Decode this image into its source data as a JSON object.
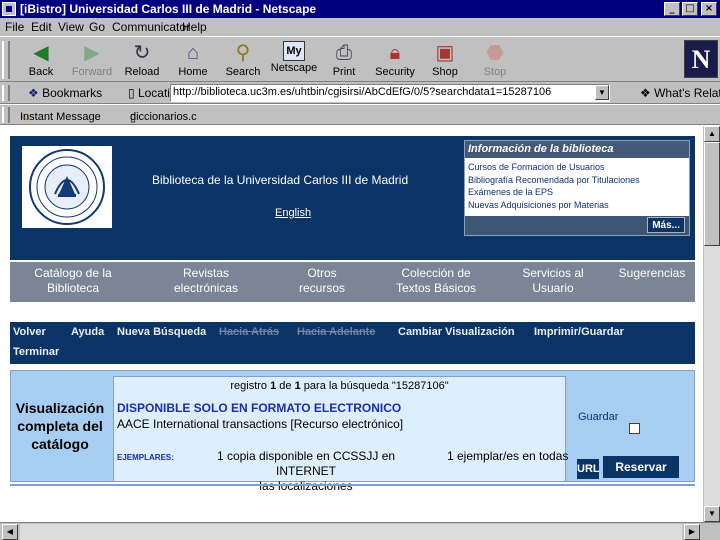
{
  "window": {
    "title": "[iBistro] Universidad Carlos III de Madrid - Netscape",
    "min": "_",
    "max": "□",
    "close": "×"
  },
  "menu": [
    "File",
    "Edit",
    "View",
    "Go",
    "Communicator",
    "Help"
  ],
  "toolbar": {
    "buttons": [
      {
        "label": "Back",
        "icon": "back-icon",
        "disabled": false
      },
      {
        "label": "Forward",
        "icon": "forward-icon",
        "disabled": true
      },
      {
        "label": "Reload",
        "icon": "reload-icon",
        "disabled": false
      },
      {
        "label": "Home",
        "icon": "home-icon",
        "disabled": false
      },
      {
        "label": "Search",
        "icon": "search-icon",
        "disabled": false
      },
      {
        "label": "Netscape",
        "icon": "netscape-icon",
        "disabled": false
      },
      {
        "label": "Print",
        "icon": "print-icon",
        "disabled": false
      },
      {
        "label": "Security",
        "icon": "security-icon",
        "disabled": false
      },
      {
        "label": "Shop",
        "icon": "shop-icon",
        "disabled": false
      },
      {
        "label": "Stop",
        "icon": "stop-icon",
        "disabled": true
      }
    ],
    "logo": "N"
  },
  "location": {
    "bookmarks_label": "Bookmarks",
    "location_label": "Location:",
    "url": "http://biblioteca.uc3m.es/uhtbin/cgisirsi/AbCdEfG/0/5?searchdata1=15287106",
    "related_label": "What's Related"
  },
  "personal": {
    "instant_message": "Instant Message",
    "diccionarios": "diccionarios.c"
  },
  "page": {
    "library_title": "Biblioteca de la Universidad Carlos III de Madrid",
    "english_link": "English",
    "info_box": {
      "title": "Información de la biblioteca",
      "items": [
        "Cursos de Formación de Usuarios",
        "Bibliografía Recomendada por Titulaciones",
        "Exámenes de la EPS",
        "Nuevas Adquisiciones por Materias"
      ],
      "more_button": "Más..."
    },
    "main_nav": [
      "Catálogo de la\nBiblioteca",
      "Revistas\nelectrónicas",
      "Otros\nrecursos",
      "Colección de\nTextos Básicos",
      "Servicios al\nUsuario",
      "Sugerencias"
    ],
    "tools": {
      "volver": "Volver",
      "ayuda": "Ayuda",
      "nueva_busqueda": "Nueva Búsqueda",
      "hacia_atras": "Hacia Atrás",
      "hacia_adelante": "Hacia Adelante",
      "cambiar": "Cambiar Visualización",
      "imprimir": "Imprimir/Guardar",
      "terminar": "Terminar"
    },
    "result": {
      "side_label": "Visualización completa del catálogo",
      "registro_prefix": "registro",
      "registro_num": "1",
      "registro_de": "de",
      "registro_total": "1",
      "registro_suffix": "para la búsqueda \"15287106\"",
      "disponible": "DISPONIBLE SOLO EN FORMATO ELECTRONICO",
      "title": "AACE International transactions [Recurso electrónico]",
      "ejemplares_label": "EJEMPLARES:",
      "ejemplares_text": "1 copia disponible en CCSSJJ en INTERNET",
      "ejemplares_localizaciones": "las localizaciones",
      "ejemplares_todas": "1 ejemplar/es en todas",
      "guardar": "Guardar",
      "url_badge": "URL",
      "reservar": "Reservar"
    }
  },
  "colors": {
    "title_bar": "#00007f",
    "chrome": "#c0c0c0",
    "header_navy": "#0b3466",
    "nav_gray": "#7b8596",
    "result_blue": "#a8cdf2",
    "record_box": "#ddeefc",
    "link_blue": "#1b2cb5"
  }
}
